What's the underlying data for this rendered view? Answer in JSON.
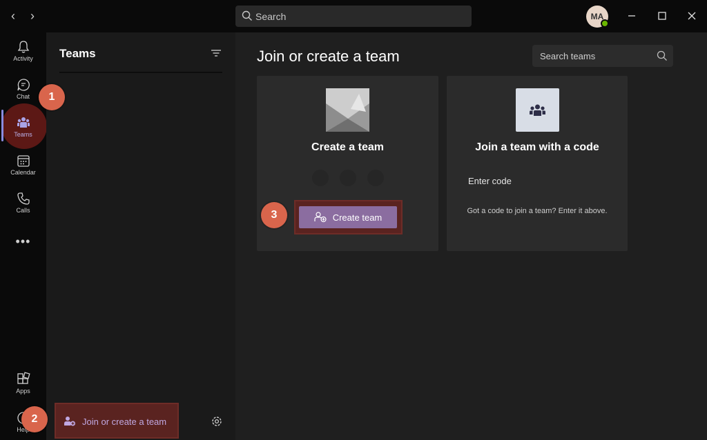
{
  "search": {
    "placeholder": "Search"
  },
  "user": {
    "initials": "MA"
  },
  "rail": {
    "items": [
      {
        "label": "Activity",
        "icon": "bell-icon"
      },
      {
        "label": "Chat",
        "icon": "chat-icon"
      },
      {
        "label": "Teams",
        "icon": "teams-icon"
      },
      {
        "label": "Calendar",
        "icon": "calendar-icon"
      },
      {
        "label": "Calls",
        "icon": "phone-icon"
      },
      {
        "label": "Apps",
        "icon": "apps-icon"
      },
      {
        "label": "Help",
        "icon": "help-icon"
      }
    ],
    "more": "•••"
  },
  "badges": {
    "one": "1",
    "two": "2",
    "three": "3"
  },
  "panel": {
    "title": "Teams",
    "join_label": "Join or create a team"
  },
  "main": {
    "title": "Join or create a team",
    "search_placeholder": "Search teams",
    "create_card": {
      "title": "Create a team",
      "button_label": "Create team"
    },
    "join_card": {
      "title": "Join a team with a code",
      "code_placeholder": "Enter code",
      "hint": "Got a code to join a team? Enter it above."
    }
  },
  "colors": {
    "accent": "#8b6da0",
    "badge": "#d9654c",
    "highlight": "#5a2320",
    "link": "#c0a8e2"
  }
}
